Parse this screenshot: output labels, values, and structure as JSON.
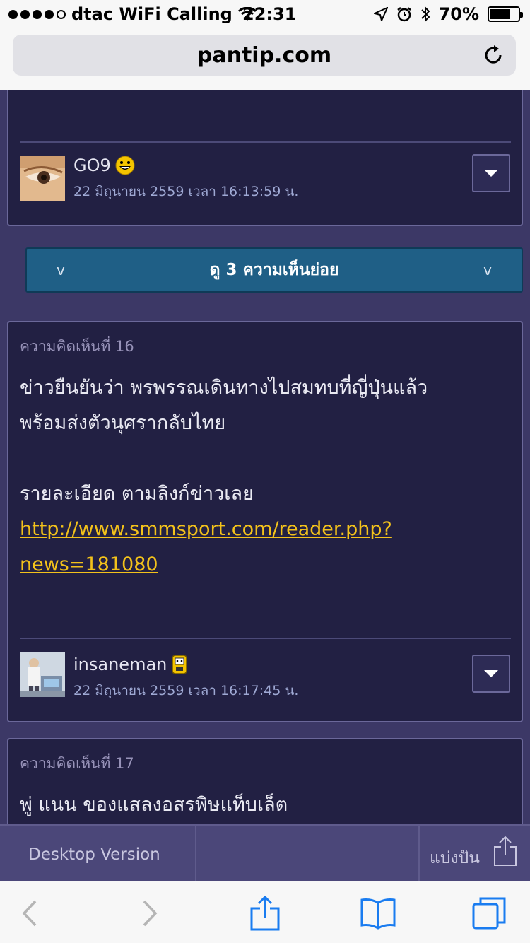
{
  "status_bar": {
    "carrier": "dtac WiFi Calling",
    "time": "22:31",
    "battery": "70%",
    "battery_level": 0.7
  },
  "browser": {
    "url": "pantip.com"
  },
  "top_comment": {
    "author": "GO9",
    "date": "22 มิถุนายน 2559 เวลา 16:13:59 น."
  },
  "expand_replies": {
    "label": "ดู 3 ความเห็นย่อย",
    "left_chevron": "v",
    "right_chevron": "v"
  },
  "comment16": {
    "number": "ความคิดเห็นที่ 16",
    "line1": "ข่าวยืนยันว่า พรพรรณเดินทางไปสมทบที่ญี่ปุ่นแล้ว",
    "line2": "พร้อมส่งตัวนุศรากลับไทย",
    "line3": "รายละเอียด ตามลิงก์ข่าวเลย",
    "link_line1": "http://www.smmsport.com/reader.php?",
    "link_line2": "news=181080",
    "author": "insaneman",
    "date": "22 มิถุนายน 2559 เวลา 16:17:45 น."
  },
  "comment17": {
    "number": "ความคิดเห็นที่ 17",
    "line1": "พู่ แนน ของแสลงอสรพิษแท็บเล็ต"
  },
  "web_bar": {
    "desktop_version": "Desktop Version",
    "share_label": "แบ่งปัน"
  },
  "icons": {
    "location": "location-arrow-icon",
    "alarm": "alarm-icon",
    "bluetooth": "bluetooth-icon",
    "reload": "reload-icon",
    "back": "back-arrow-icon",
    "forward": "forward-arrow-icon",
    "share": "share-icon",
    "bookmarks": "bookmarks-icon",
    "tabs": "tabs-icon"
  }
}
